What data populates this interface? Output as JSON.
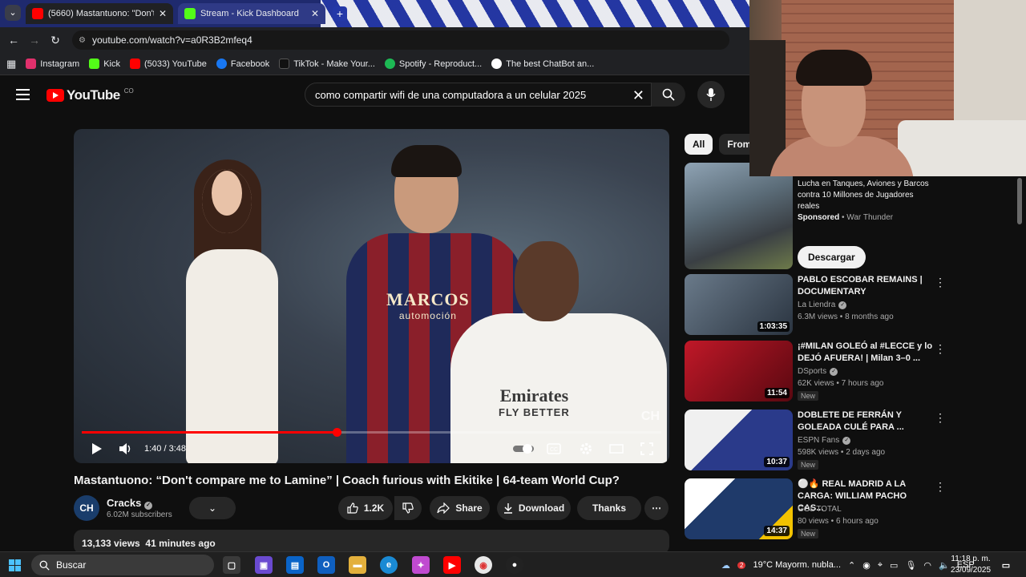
{
  "browser": {
    "tabs": [
      {
        "title": "(5660) Mastantuono: \"Don't co",
        "favicon": "youtube-icon",
        "active": true
      },
      {
        "title": "Stream - Kick Dashboard",
        "favicon": "kick-icon",
        "active": false
      }
    ],
    "url": "youtube.com/watch?v=a0R3B2mfeq4",
    "bookmarks": [
      {
        "label": "Instagram",
        "icon": "instagram-icon",
        "color": "#e1306c"
      },
      {
        "label": "Kick",
        "icon": "kick-icon",
        "color": "#53fc18"
      },
      {
        "label": "(5033) YouTube",
        "icon": "youtube-icon",
        "color": "#ff0000"
      },
      {
        "label": "Facebook",
        "icon": "facebook-icon",
        "color": "#1877f2"
      },
      {
        "label": "TikTok - Make Your...",
        "icon": "tiktok-icon",
        "color": "#111111"
      },
      {
        "label": "Spotify - Reproduct...",
        "icon": "spotify-icon",
        "color": "#1db954"
      },
      {
        "label": "The best ChatBot an...",
        "icon": "chatgpt-icon",
        "color": "#ffffff"
      }
    ]
  },
  "youtube": {
    "logo_text": "YouTube",
    "country_code": "CO",
    "search_query": "como compartir wifi de una computadora a un celular 2025",
    "accent": "#ff0000"
  },
  "player": {
    "time": "1:40 / 3:48",
    "progress_fraction": 0.44,
    "buffer_fraction": 0.53,
    "shirt_text_1": "MARCOS",
    "shirt_text_1_sub": "automoción",
    "shirt_text_2": "Emirates",
    "shirt_text_2_sub": "FLY BETTER",
    "watermark": "CH"
  },
  "video": {
    "title": "Mastantuono: “Don't compare me to Lamine” | Coach furious with Ekitike | 64-team World Cup?",
    "channel": "Cracks",
    "channel_avatar": "CH",
    "subscribers": "6.02M subscribers",
    "likes": "1.2K",
    "share_label": "Share",
    "download_label": "Download",
    "thanks_label": "Thanks",
    "views": "13,133 views",
    "posted": "41 minutes ago"
  },
  "sidebar": {
    "chips": [
      "All",
      "From C"
    ],
    "ad": {
      "text": "Lucha en Tanques, Aviones y Barcos contra 10 Millones de Jugadores reales",
      "sponsored": "Sponsored",
      "advertiser": "War Thunder",
      "button": "Descargar"
    },
    "related": [
      {
        "title": "PABLO ESCOBAR REMAINS | DOCUMENTARY",
        "channel": "La Liendra",
        "verified": true,
        "meta": "6.3M views • 8 months ago",
        "duration": "1:03:35",
        "new": "",
        "thumb": "#4a5a6a"
      },
      {
        "title": "¡#MILAN GOLEÓ al #LECCE y lo DEJÓ AFUERA! | Milan 3–0 ...",
        "channel": "DSports",
        "verified": true,
        "meta": "62K views • 7 hours ago",
        "duration": "11:54",
        "new": "New",
        "thumb": "#b01020"
      },
      {
        "title": "DOBLETE DE FERRÁN Y GOLEADA CULÉ PARA ...",
        "channel": "ESPN Fans",
        "verified": true,
        "meta": "598K views • 2 days ago",
        "duration": "10:37",
        "new": "New",
        "thumb": "#2a3a8a"
      },
      {
        "title": "⚪🔥 REAL MADRID A LA CARGA: WILLIAM PACHO CAS...",
        "channel": "GOL TOTAL",
        "verified": false,
        "meta": "80 views • 6 hours ago",
        "duration": "14:37",
        "new": "New",
        "thumb": "#1f3a6a"
      }
    ]
  },
  "taskbar": {
    "search_placeholder": "Buscar",
    "weather": "19°C  Mayorm. nubla...",
    "lang": "ESP",
    "time": "11:18 p. m.",
    "date": "23/09/2025",
    "notification_count": "2"
  }
}
